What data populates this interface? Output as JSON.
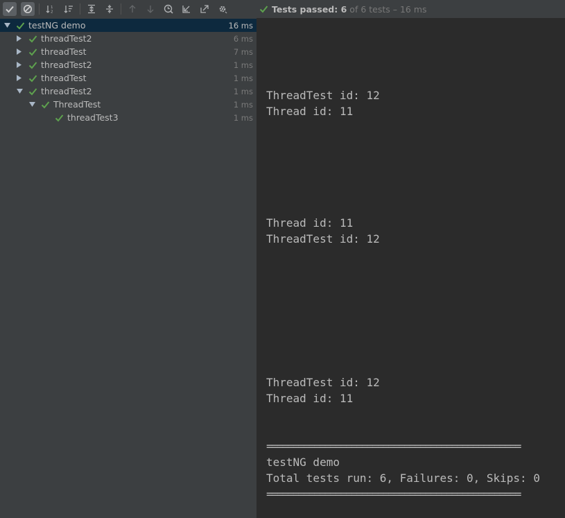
{
  "toolbar": {
    "buttons": [
      {
        "icon": "check-icon",
        "state": "active"
      },
      {
        "icon": "cancel-circle-icon",
        "state": "active"
      },
      {
        "icon": "sort-alpha-icon",
        "state": "normal"
      },
      {
        "icon": "sort-duration-icon",
        "state": "normal"
      },
      {
        "icon": "expand-all-icon",
        "state": "normal"
      },
      {
        "icon": "collapse-all-icon",
        "state": "normal"
      },
      {
        "icon": "arrow-up-icon",
        "state": "disabled"
      },
      {
        "icon": "arrow-down-icon",
        "state": "disabled"
      },
      {
        "icon": "history-icon",
        "state": "normal"
      },
      {
        "icon": "import-icon",
        "state": "normal"
      },
      {
        "icon": "export-icon",
        "state": "normal"
      },
      {
        "icon": "settings-gear-icon",
        "state": "normal"
      }
    ]
  },
  "status": {
    "passed": "Tests passed: 6",
    "rest": "of 6 tests – 16 ms"
  },
  "tree": {
    "items": [
      {
        "label": "testNG demo",
        "duration": "16 ms",
        "depth": 0,
        "expanded": true,
        "selected": true
      },
      {
        "label": "threadTest2",
        "duration": "6 ms",
        "depth": 1,
        "expanded": false
      },
      {
        "label": "threadTest",
        "duration": "7 ms",
        "depth": 1,
        "expanded": false
      },
      {
        "label": "threadTest2",
        "duration": "1 ms",
        "depth": 1,
        "expanded": false
      },
      {
        "label": "threadTest",
        "duration": "1 ms",
        "depth": 1,
        "expanded": false
      },
      {
        "label": "threadTest2",
        "duration": "1 ms",
        "depth": 1,
        "expanded": true
      },
      {
        "label": "ThreadTest",
        "duration": "1 ms",
        "depth": 2,
        "expanded": true
      },
      {
        "label": "threadTest3",
        "duration": "1 ms",
        "depth": 3,
        "leaf": true
      }
    ]
  },
  "console": {
    "lines": [
      "ThreadTest id: 12",
      "Thread id: 11",
      "Thread id: 11",
      "ThreadTest id: 12",
      "ThreadTest id: 12",
      "Thread id: 11",
      "================================================",
      "testNG demo",
      "Total tests run: 6, Failures: 0, Skips: 0",
      "================================================"
    ]
  },
  "colors": {
    "pass_green": "#5ea24e",
    "selection": "#0d293e",
    "panel": "#3c3f41",
    "console_bg": "#2b2b2b"
  }
}
